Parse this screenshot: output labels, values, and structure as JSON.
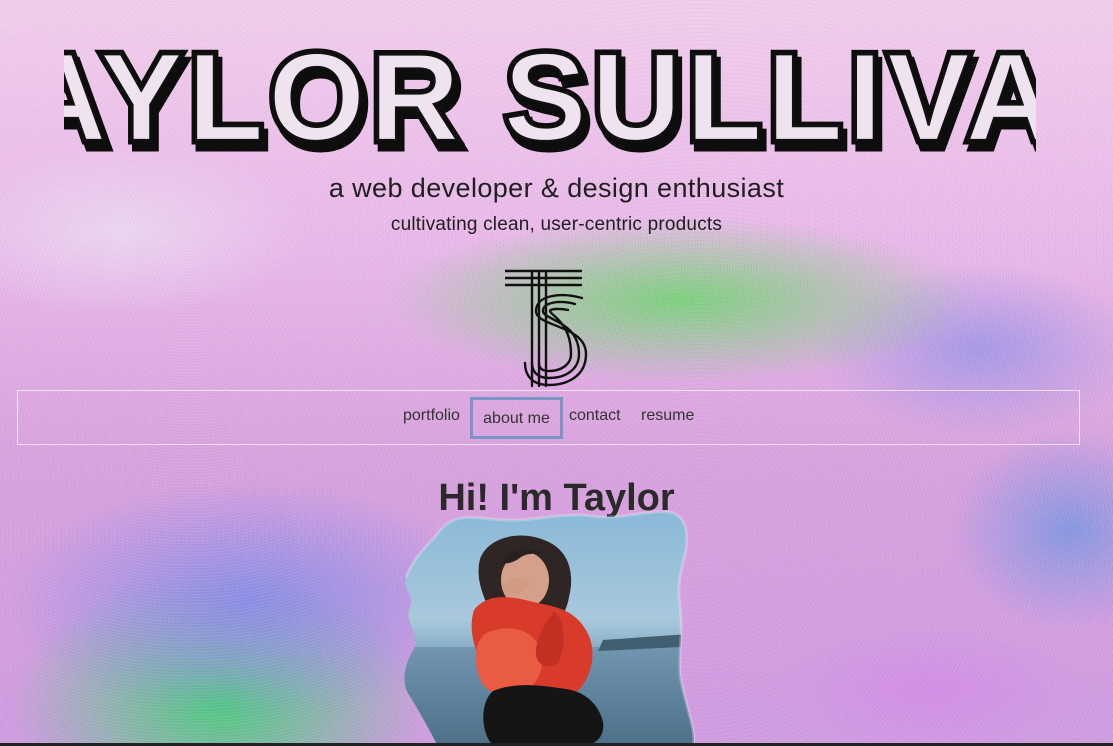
{
  "header": {
    "name": "TAYLOR SULLIVAN",
    "tagline": "a web developer & design enthusiast",
    "subtagline": "cultivating clean, user-centric products",
    "monogram_name": "TS"
  },
  "nav": {
    "items": [
      {
        "label": "portfolio"
      },
      {
        "label": "about me"
      },
      {
        "label": "contact"
      },
      {
        "label": "resume"
      }
    ]
  },
  "main": {
    "heading": "Hi! I'm Taylor"
  },
  "colors": {
    "accent_border": "#468cb4",
    "text": "#202020"
  }
}
